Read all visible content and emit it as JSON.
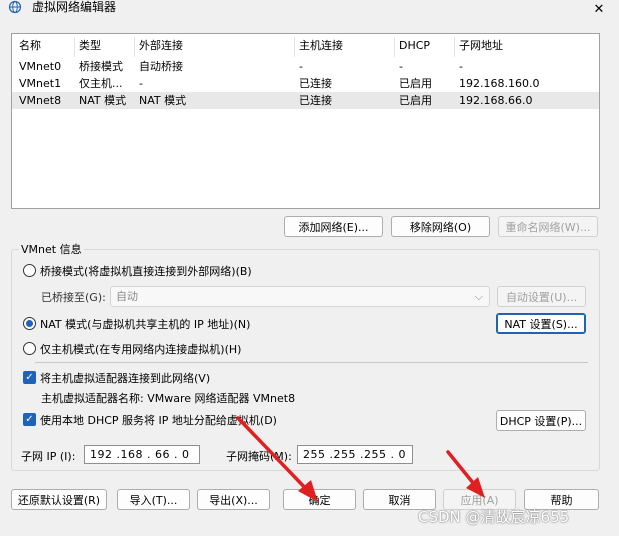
{
  "window": {
    "title": "虚拟网络编辑器",
    "close_symbol": "✕"
  },
  "network_table": {
    "columns": [
      "名称",
      "类型",
      "外部连接",
      "主机连接",
      "DHCP",
      "子网地址"
    ],
    "rows": [
      {
        "name": "VMnet0",
        "type": "桥接模式",
        "external": "自动桥接",
        "host": "-",
        "dhcp": "-",
        "subnet": "-"
      },
      {
        "name": "VMnet1",
        "type": "仅主机...",
        "external": "-",
        "host": "已连接",
        "dhcp": "已启用",
        "subnet": "192.168.160.0"
      },
      {
        "name": "VMnet8",
        "type": "NAT 模式",
        "external": "NAT 模式",
        "host": "已连接",
        "dhcp": "已启用",
        "subnet": "192.168.66.0"
      }
    ],
    "selected_row": 2
  },
  "table_buttons": {
    "add": "添加网络(E)...",
    "remove": "移除网络(O)",
    "rename": "重命名网络(W)..."
  },
  "vmnet_info": {
    "group_title": "VMnet 信息",
    "bridged_label": "桥接模式(将虚拟机直接连接到外部网络)(B)",
    "bridged_to_label": "已桥接至(G):",
    "bridged_to_value": "自动",
    "auto_settings": "自动设置(U)...",
    "nat_label": "NAT 模式(与虚拟机共享主机的 IP 地址)(N)",
    "nat_settings": "NAT 设置(S)...",
    "hostonly_label": "仅主机模式(在专用网络内连接虚拟机)(H)",
    "selected_mode": "nat",
    "connect_adapter_label": "将主机虚拟适配器连接到此网络(V)",
    "connect_adapter_checked": true,
    "adapter_name_text": "主机虚拟适配器名称: VMware 网络适配器 VMnet8",
    "dhcp_label": "使用本地 DHCP 服务将 IP 地址分配给虚拟机(D)",
    "dhcp_checked": true,
    "dhcp_settings": "DHCP 设置(P)...",
    "subnet_ip_label": "子网 IP (I):",
    "subnet_ip_value": "192 .168 . 66 . 0",
    "subnet_mask_label": "子网掩码(M):",
    "subnet_mask_value": "255 .255 .255 . 0"
  },
  "footer_buttons": {
    "restore": "还原默认设置(R)",
    "import": "导入(T)...",
    "export": "导出(X)...",
    "ok": "确定",
    "cancel": "取消",
    "apply": "应用(A)",
    "help": "帮助"
  },
  "watermark": "CSDN @清故宸凉655",
  "colors": {
    "accent": "#1e63b8",
    "annotation_arrow": "#e02020"
  }
}
